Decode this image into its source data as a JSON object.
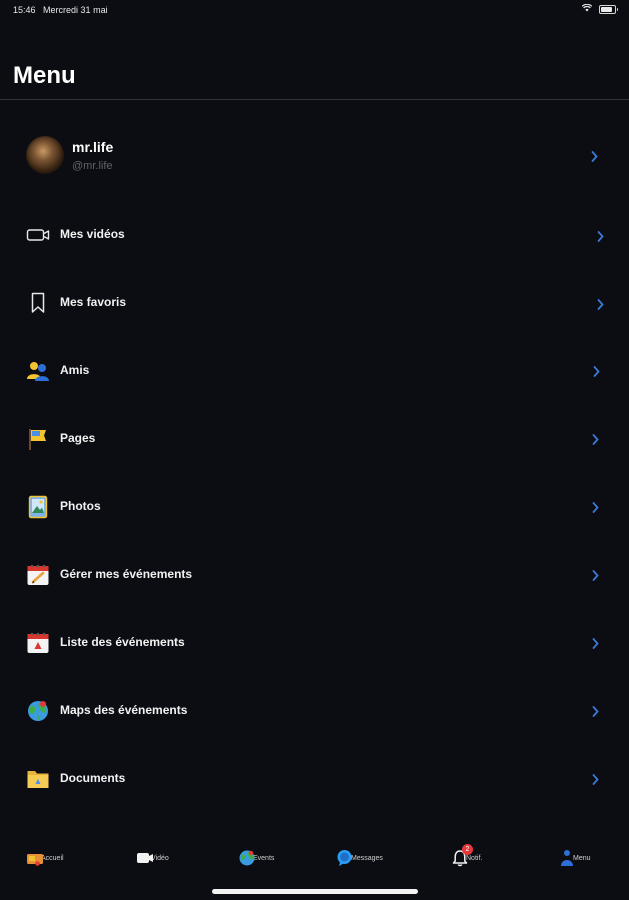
{
  "status_bar": {
    "time": "15:46",
    "date": "Mercredi 31 mai"
  },
  "page": {
    "title": "Menu"
  },
  "profile": {
    "name": "mr.life",
    "handle": "@mr.life"
  },
  "menu_items": [
    {
      "label": "Mes vidéos",
      "icon": "video-camera-icon"
    },
    {
      "label": "Mes favoris",
      "icon": "bookmark-icon"
    },
    {
      "label": "Amis",
      "icon": "friends-icon"
    },
    {
      "label": "Pages",
      "icon": "flag-icon"
    },
    {
      "label": "Photos",
      "icon": "photo-icon"
    },
    {
      "label": "Gérer mes événements",
      "icon": "calendar-edit-icon"
    },
    {
      "label": "Liste des événements",
      "icon": "calendar-icon"
    },
    {
      "label": "Maps des événements",
      "icon": "globe-icon"
    },
    {
      "label": "Documents",
      "icon": "folder-icon"
    }
  ],
  "tab_bar": {
    "tabs": [
      {
        "label": "Accueil",
        "icon": "home-icon"
      },
      {
        "label": "Vidéo",
        "icon": "video-icon"
      },
      {
        "label": "Events",
        "icon": "globe-icon"
      },
      {
        "label": "Messages",
        "icon": "messages-icon"
      },
      {
        "label": "Notif.",
        "icon": "bell-icon",
        "badge": "2"
      },
      {
        "label": "Menu",
        "icon": "menu-icon"
      }
    ]
  },
  "colors": {
    "background": "#0b0d12",
    "accent": "#3a7bd5",
    "badge": "#e5383b",
    "secondary_text": "#5f636b"
  }
}
